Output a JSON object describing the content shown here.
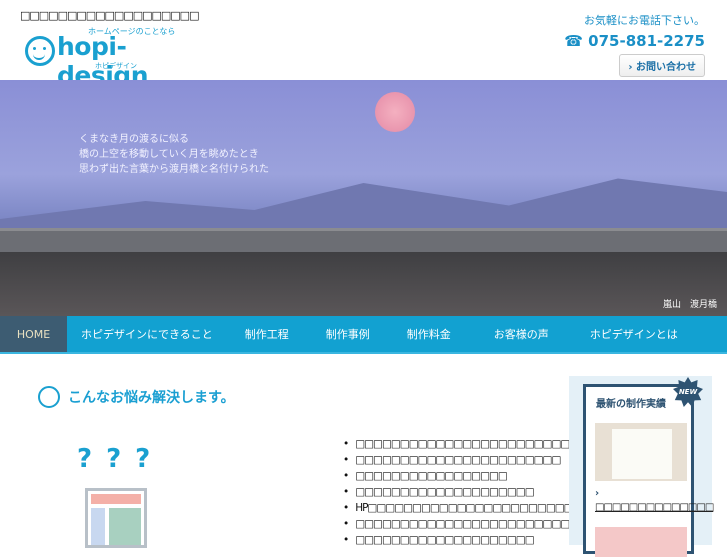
{
  "header": {
    "top_text": "□□□□□□□□□□□□□□□□□□□",
    "logo_tagline": "ホームページのことなら",
    "logo_name": "hopi-design",
    "logo_kana": "ホピデザイン",
    "contact_msg": "お気軽にお電話下さい。",
    "phone": "☎ 075-881-2275",
    "contact_button": "› お問い合わせ"
  },
  "hero": {
    "lines": [
      "くまなき月の渡るに似る",
      "橋の上空を移動していく月を眺めたとき",
      "思わず出た言葉から渡月橋と名付けられた"
    ],
    "caption": "嵐山　渡月橋"
  },
  "nav": [
    "HOME",
    "ホピデザインにできること",
    "制作工程",
    "制作事例",
    "制作料金",
    "お客様の声",
    "ホピデザインとは"
  ],
  "main": {
    "heading": "こんなお悩み解決します。",
    "question_marks": "???",
    "items": [
      "□□□□□□□□□□□□□□□□□□□□□□□□",
      "□□□□□□□□□□□□□□□□□□□□□□□",
      "□□□□□□□□□□□□□□□□□",
      "□□□□□□□□□□□□□□□□□□□□",
      "HP□□□□□□□□□□□□□□□□□□□□□□□",
      "□□□□□□□□□□□□□□□□□□□□□□□□",
      "□□□□□□□□□□□□□□□□□□□□"
    ]
  },
  "sidebar": {
    "title": "最新の制作実績",
    "badge": "NEW",
    "link": "□□□□□□□□□□□□□□"
  }
}
